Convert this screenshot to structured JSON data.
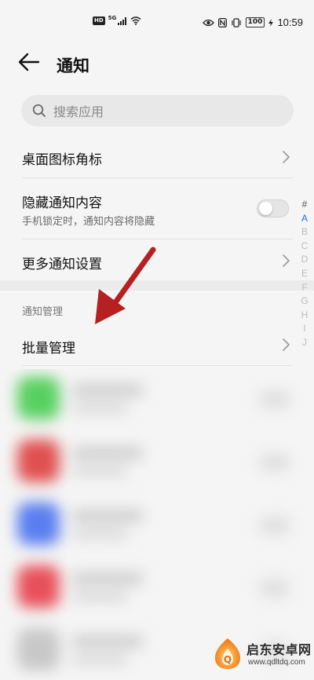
{
  "status_bar": {
    "hd": "HD",
    "network": "5G",
    "battery": "100",
    "time": "10:59"
  },
  "header": {
    "title": "通知"
  },
  "search": {
    "placeholder": "搜索应用"
  },
  "settings": {
    "desktop_badge_label": "桌面图标角标",
    "hide_content_label": "隐藏通知内容",
    "hide_content_sub": "手机锁定时，通知内容将隐藏",
    "hide_content_enabled": false,
    "more_settings_label": "更多通知设置"
  },
  "section": {
    "title": "通知管理",
    "batch_label": "批量管理"
  },
  "alpha_index": [
    "#",
    "A",
    "B",
    "C",
    "D",
    "E",
    "F",
    "G",
    "H",
    "I",
    "J"
  ],
  "alpha_active": "A",
  "blurred_apps": [
    {
      "icon_color": "#58d060"
    },
    {
      "icon_color": "#e05050"
    },
    {
      "icon_color": "#5a7ef0"
    },
    {
      "icon_color": "#e8505a"
    },
    {
      "icon_color": "#c8c8c8"
    }
  ],
  "annotation": {
    "arrow_color": "#b52020"
  },
  "watermark": {
    "name": "启东安卓网",
    "url": "www.qdltdq.com"
  }
}
